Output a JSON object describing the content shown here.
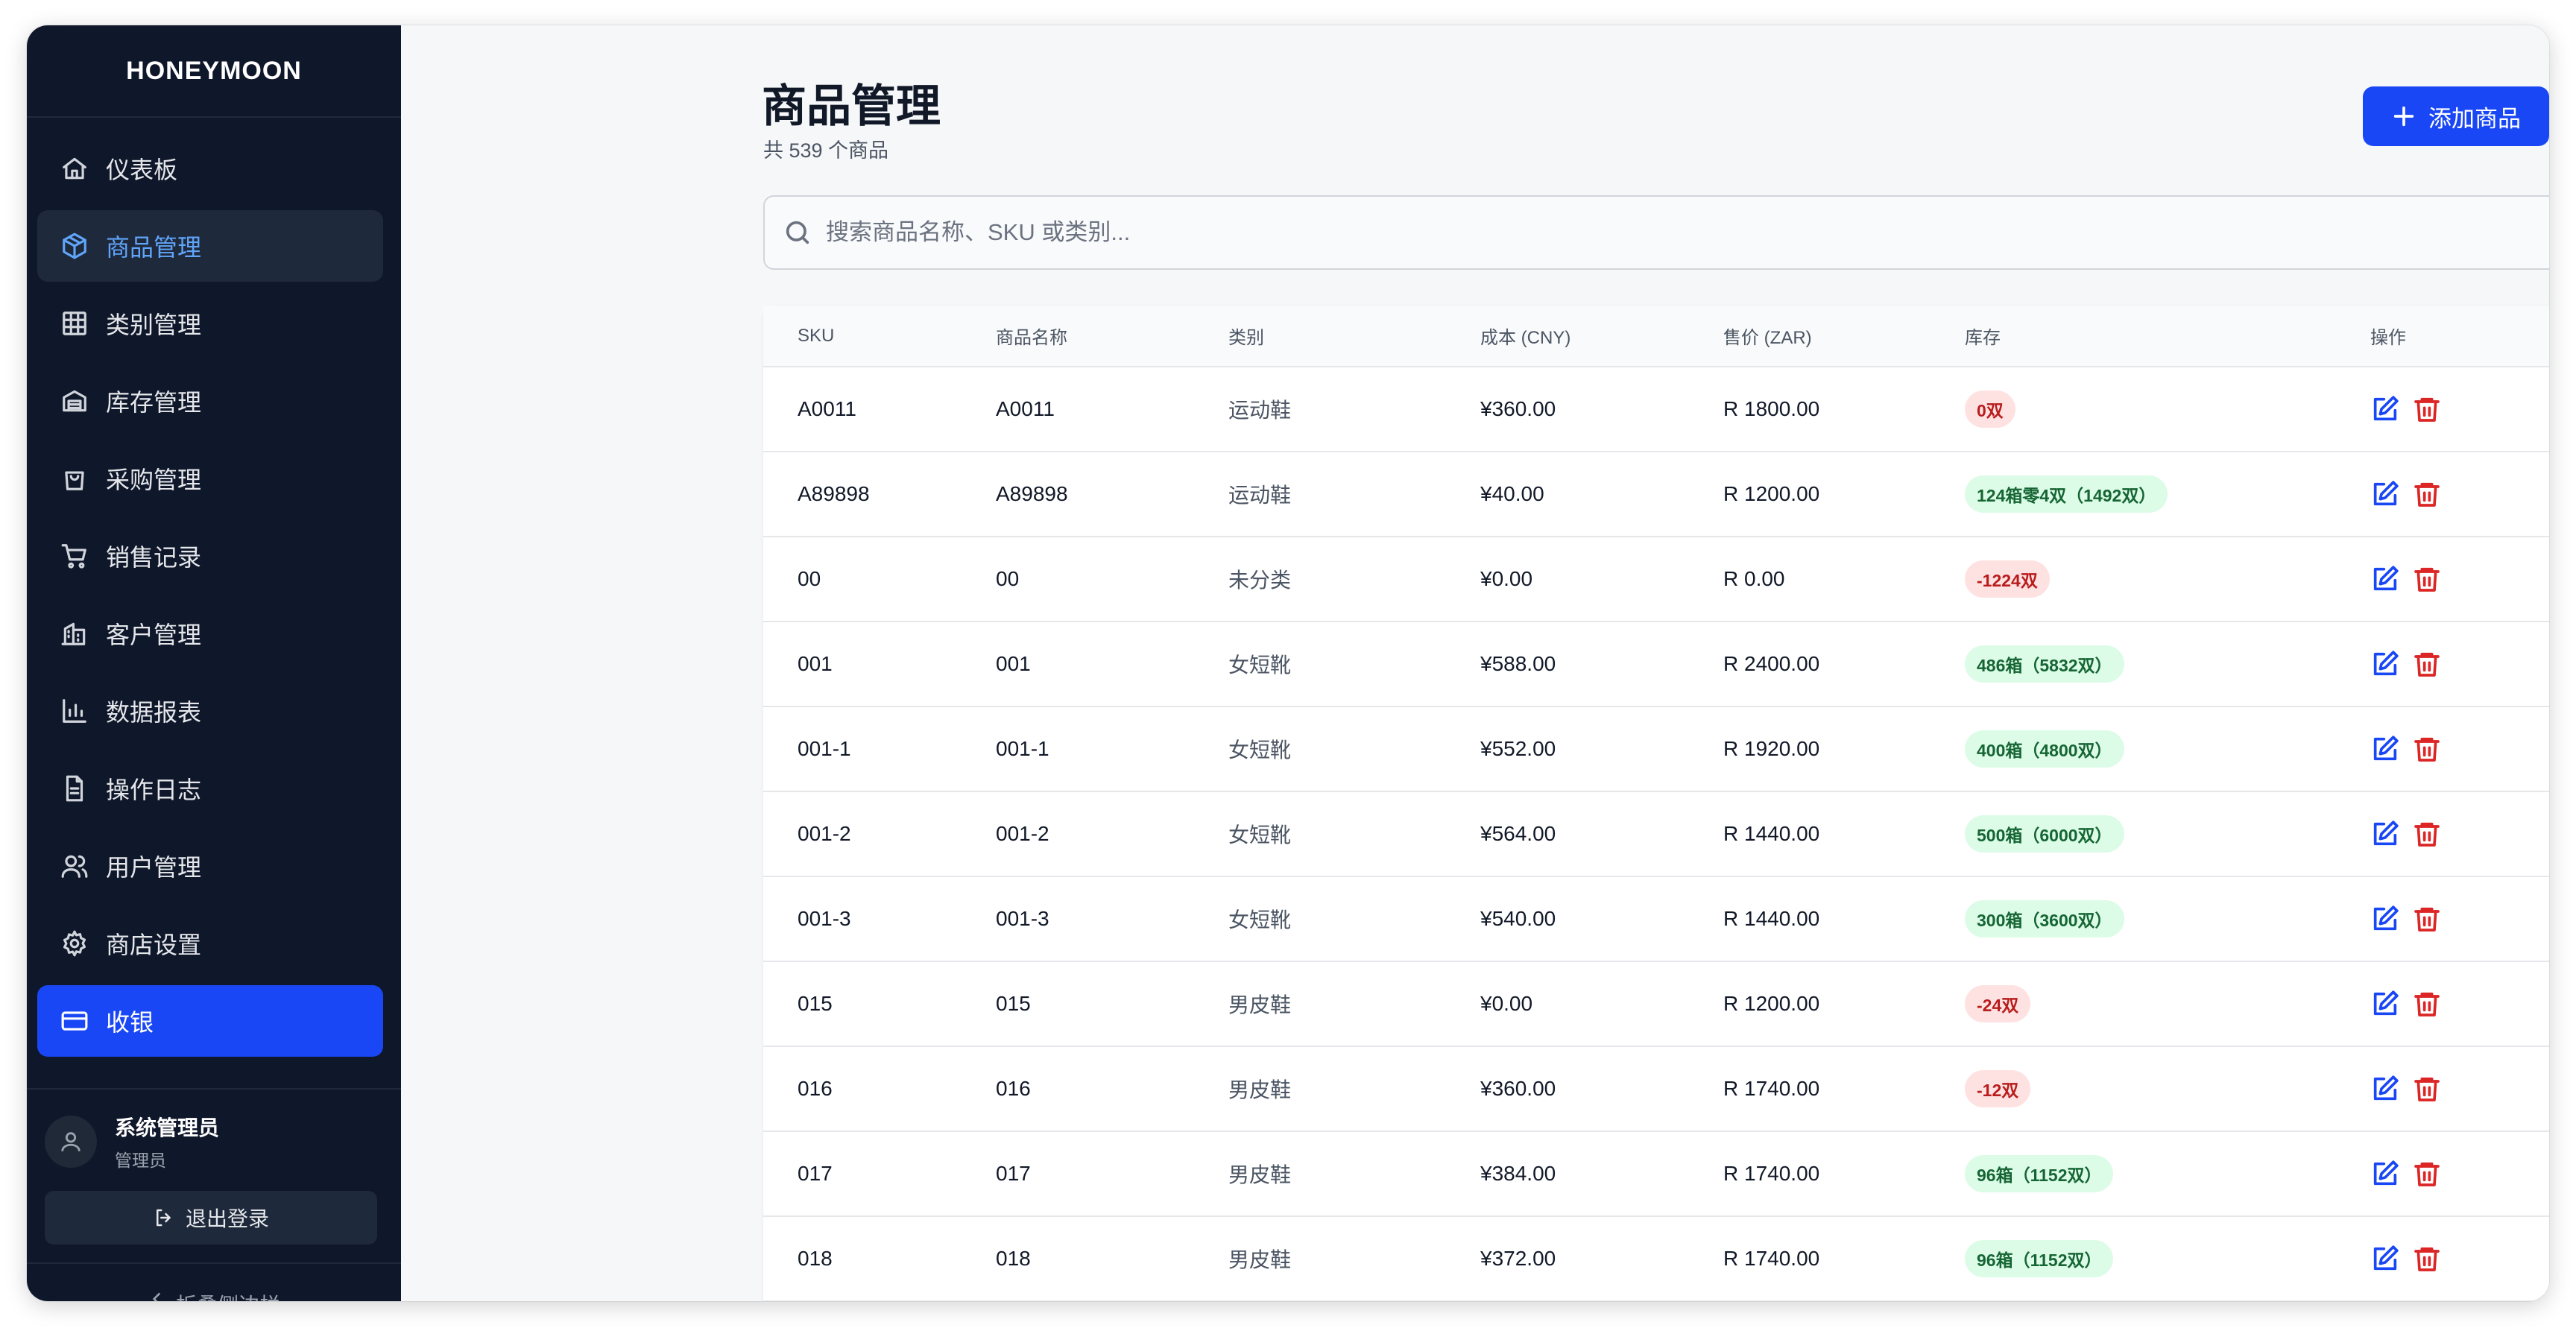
{
  "brand": "HONEYMOON",
  "sidebar": {
    "items": [
      {
        "label": "仪表板",
        "icon": "home-icon",
        "state": "normal"
      },
      {
        "label": "商品管理",
        "icon": "package-icon",
        "state": "current"
      },
      {
        "label": "类别管理",
        "icon": "grid-icon",
        "state": "normal"
      },
      {
        "label": "库存管理",
        "icon": "warehouse-icon",
        "state": "normal"
      },
      {
        "label": "采购管理",
        "icon": "shopping-bag-icon",
        "state": "normal"
      },
      {
        "label": "销售记录",
        "icon": "cart-icon",
        "state": "normal"
      },
      {
        "label": "客户管理",
        "icon": "building-icon",
        "state": "normal"
      },
      {
        "label": "数据报表",
        "icon": "bar-chart-icon",
        "state": "normal"
      },
      {
        "label": "操作日志",
        "icon": "file-text-icon",
        "state": "normal"
      },
      {
        "label": "用户管理",
        "icon": "users-icon",
        "state": "normal"
      },
      {
        "label": "商店设置",
        "icon": "gear-icon",
        "state": "normal"
      },
      {
        "label": "收银",
        "icon": "credit-card-icon",
        "state": "primary"
      }
    ],
    "user": {
      "name": "系统管理员",
      "role": "管理员"
    },
    "logout_label": "退出登录",
    "collapse_label": "折叠侧边栏"
  },
  "header": {
    "title": "商品管理",
    "subtitle": "共 539 个商品",
    "add_label": "添加商品"
  },
  "search": {
    "placeholder": "搜索商品名称、SKU 或类别...",
    "value": ""
  },
  "table": {
    "columns": [
      "SKU",
      "商品名称",
      "类别",
      "成本 (CNY)",
      "售价 (ZAR)",
      "库存",
      "操作"
    ],
    "rows": [
      {
        "sku": "A0011",
        "name": "A0011",
        "category": "运动鞋",
        "cost": "¥360.00",
        "price": "R 1800.00",
        "stock": "0双",
        "stock_status": "red"
      },
      {
        "sku": "A89898",
        "name": "A89898",
        "category": "运动鞋",
        "cost": "¥40.00",
        "price": "R 1200.00",
        "stock": "124箱零4双（1492双）",
        "stock_status": "green"
      },
      {
        "sku": "00",
        "name": "00",
        "category": "未分类",
        "cost": "¥0.00",
        "price": "R 0.00",
        "stock": "-1224双",
        "stock_status": "red"
      },
      {
        "sku": "001",
        "name": "001",
        "category": "女短靴",
        "cost": "¥588.00",
        "price": "R 2400.00",
        "stock": "486箱（5832双）",
        "stock_status": "green"
      },
      {
        "sku": "001-1",
        "name": "001-1",
        "category": "女短靴",
        "cost": "¥552.00",
        "price": "R 1920.00",
        "stock": "400箱（4800双）",
        "stock_status": "green"
      },
      {
        "sku": "001-2",
        "name": "001-2",
        "category": "女短靴",
        "cost": "¥564.00",
        "price": "R 1440.00",
        "stock": "500箱（6000双）",
        "stock_status": "green"
      },
      {
        "sku": "001-3",
        "name": "001-3",
        "category": "女短靴",
        "cost": "¥540.00",
        "price": "R 1440.00",
        "stock": "300箱（3600双）",
        "stock_status": "green"
      },
      {
        "sku": "015",
        "name": "015",
        "category": "男皮鞋",
        "cost": "¥0.00",
        "price": "R 1200.00",
        "stock": "-24双",
        "stock_status": "red"
      },
      {
        "sku": "016",
        "name": "016",
        "category": "男皮鞋",
        "cost": "¥360.00",
        "price": "R 1740.00",
        "stock": "-12双",
        "stock_status": "red"
      },
      {
        "sku": "017",
        "name": "017",
        "category": "男皮鞋",
        "cost": "¥384.00",
        "price": "R 1740.00",
        "stock": "96箱（1152双）",
        "stock_status": "green"
      },
      {
        "sku": "018",
        "name": "018",
        "category": "男皮鞋",
        "cost": "¥372.00",
        "price": "R 1740.00",
        "stock": "96箱（1152双）",
        "stock_status": "green"
      }
    ]
  },
  "colors": {
    "accent": "#1a47f5",
    "sidebar_bg": "#0f172a",
    "danger": "#dc2626",
    "success": "#166534"
  }
}
